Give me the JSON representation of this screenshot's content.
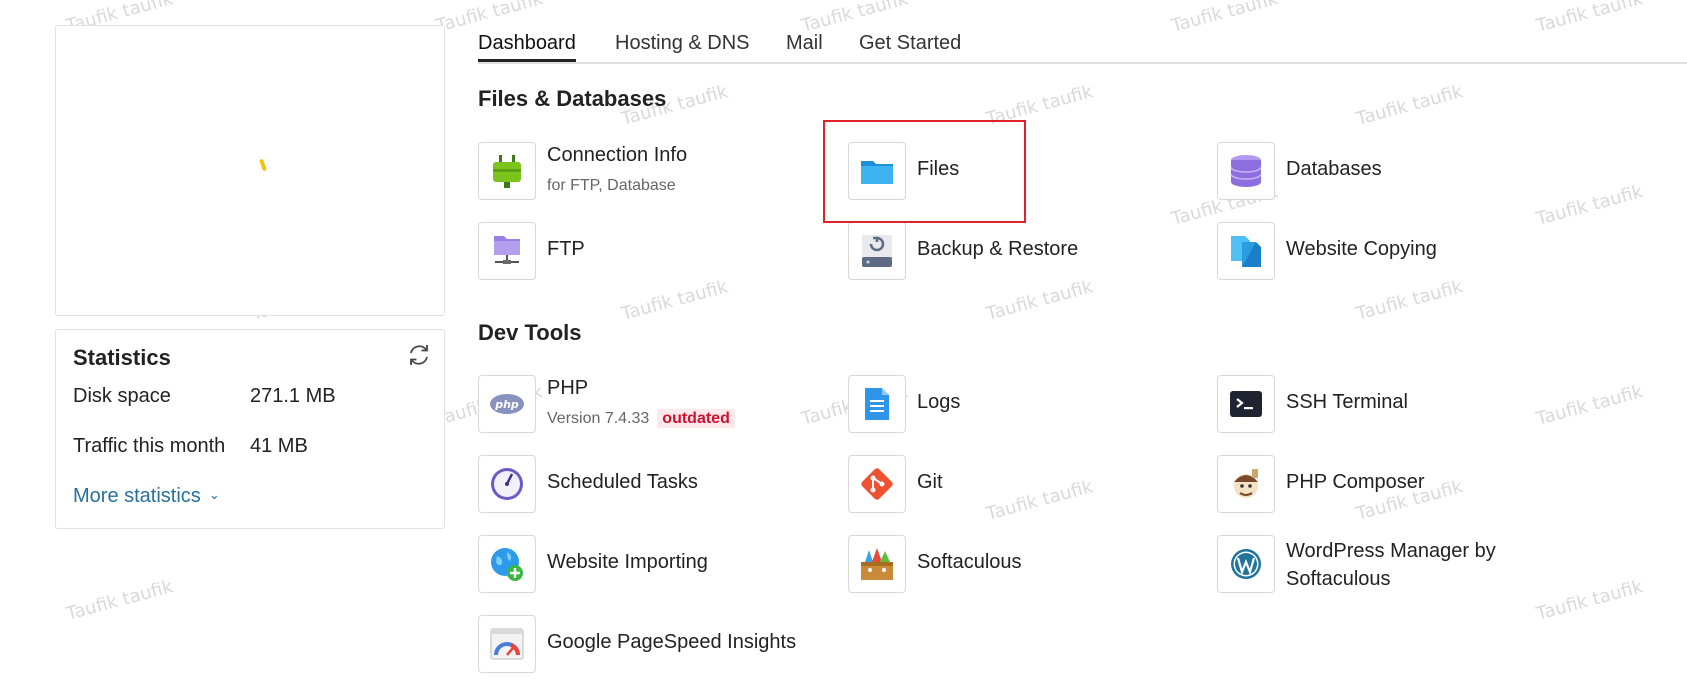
{
  "watermark": "Taufik taufik",
  "tabs": [
    {
      "label": "Dashboard",
      "active": true
    },
    {
      "label": "Hosting & DNS",
      "active": false
    },
    {
      "label": "Mail",
      "active": false
    },
    {
      "label": "Get Started",
      "active": false
    }
  ],
  "statistics": {
    "title": "Statistics",
    "disk_label": "Disk space",
    "disk_value": "271.1 MB",
    "traffic_label": "Traffic this month",
    "traffic_value": "41 MB",
    "more_label": "More statistics"
  },
  "sections": {
    "files_title": "Files & Databases",
    "dev_title": "Dev Tools"
  },
  "files": {
    "connection": {
      "label": "Connection Info",
      "sub": "for FTP, Database"
    },
    "files": {
      "label": "Files"
    },
    "databases": {
      "label": "Databases"
    },
    "ftp": {
      "label": "FTP"
    },
    "backup": {
      "label": "Backup & Restore"
    },
    "copying": {
      "label": "Website Copying"
    }
  },
  "dev": {
    "php": {
      "label": "PHP",
      "sub": "Version 7.4.33",
      "badge": "outdated"
    },
    "logs": {
      "label": "Logs"
    },
    "ssh": {
      "label": "SSH Terminal"
    },
    "tasks": {
      "label": "Scheduled Tasks"
    },
    "git": {
      "label": "Git"
    },
    "composer": {
      "label": "PHP Composer"
    },
    "importing": {
      "label": "Website Importing"
    },
    "softaculous": {
      "label": "Softaculous"
    },
    "wordpress": {
      "label": "WordPress Manager by Softaculous"
    },
    "pagespeed": {
      "label": "Google PageSpeed Insights"
    }
  },
  "colors": {
    "link": "#28709f",
    "highlight": "#e0232b",
    "badge_text": "#d0102e",
    "badge_bg": "#fde8eb"
  },
  "icons": {
    "connection": "plug-icon",
    "files": "folder-icon",
    "databases": "database-icon",
    "ftp": "ftp-folder-icon",
    "backup": "backup-drive-icon",
    "copying": "copy-pages-icon",
    "php": "php-icon",
    "logs": "log-document-icon",
    "ssh": "terminal-icon",
    "tasks": "clock-icon",
    "git": "git-icon",
    "composer": "composer-icon",
    "importing": "globe-plus-icon",
    "softaculous": "softaculous-box-icon",
    "wordpress": "wordpress-icon",
    "pagespeed": "gauge-icon"
  }
}
